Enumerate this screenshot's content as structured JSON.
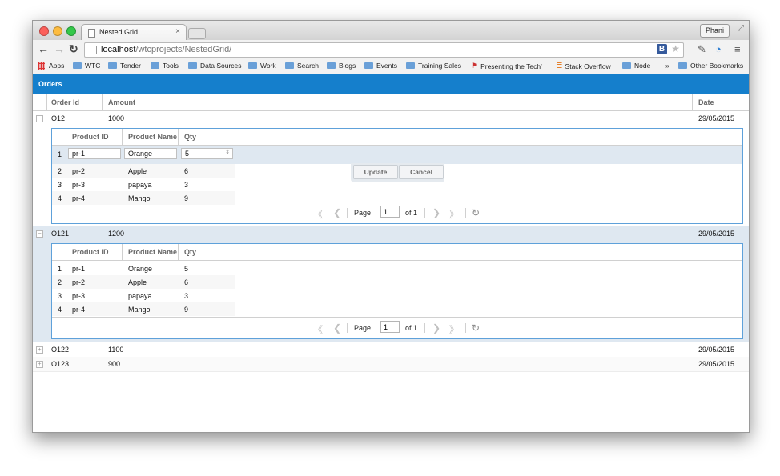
{
  "browser": {
    "tab_title": "Nested Grid",
    "tab_close": "×",
    "user_name": "Phani",
    "url_host": "localhost",
    "url_path": "/wtcprojects/NestedGrid/",
    "b_button": "B"
  },
  "bookmarks": {
    "items": [
      "Apps",
      "WTC",
      "Tender",
      "Tools",
      "Data Sources",
      "Work",
      "Search",
      "Blogs",
      "Events",
      "Training Sales",
      "Presenting the Tech’",
      "Stack Overflow",
      "Node"
    ],
    "more": "»",
    "other": "Other Bookmarks"
  },
  "grid": {
    "title": "Orders",
    "columns": [
      "Order Id",
      "Amount",
      "Date"
    ],
    "rows": [
      {
        "expander": "−",
        "id": "O12",
        "amount": "1000",
        "date": "29/05/2015"
      },
      {
        "expander": "−",
        "id": "O121",
        "amount": "1200",
        "date": "29/05/2015"
      },
      {
        "expander": "+",
        "id": "O122",
        "amount": "1100",
        "date": "29/05/2015"
      },
      {
        "expander": "+",
        "id": "O123",
        "amount": "900",
        "date": "29/05/2015"
      }
    ]
  },
  "nested": {
    "columns": [
      "Product ID",
      "Product Name",
      "Qty"
    ],
    "rows": [
      {
        "n": "1",
        "id": "pr-1",
        "name": "Orange",
        "qty": "5"
      },
      {
        "n": "2",
        "id": "pr-2",
        "name": "Apple",
        "qty": "6"
      },
      {
        "n": "3",
        "id": "pr-3",
        "name": "papaya",
        "qty": "3"
      },
      {
        "n": "4",
        "id": "pr-4",
        "name": "Mango",
        "qty": "9"
      }
    ],
    "editor": {
      "id_value": "pr-1",
      "name_value": "Orange",
      "qty_value": "5",
      "update_label": "Update",
      "cancel_label": "Cancel"
    },
    "pager": {
      "page_label": "Page",
      "page_value": "1",
      "of_label": "of 1"
    }
  },
  "icons": {
    "first": "《",
    "prev": "❮",
    "next": "❯",
    "last": "》",
    "refresh": "↻"
  }
}
